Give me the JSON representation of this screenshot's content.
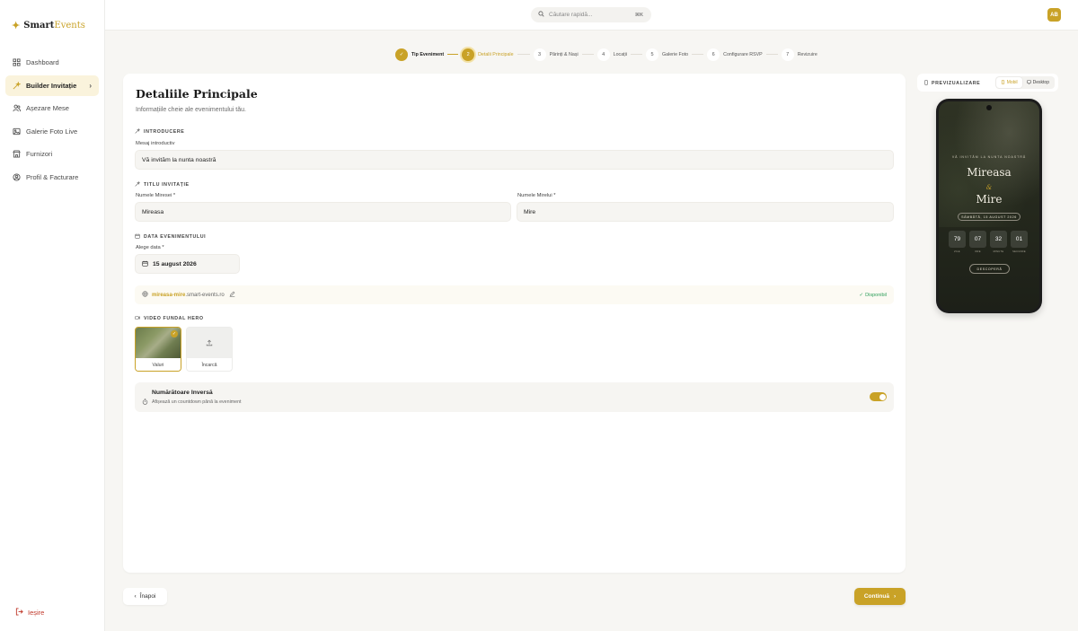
{
  "app": {
    "brand_name_part1": "Smart",
    "brand_name_part2": "Events",
    "accent_color": "#c9a227"
  },
  "sidebar": {
    "items": [
      {
        "label": "Dashboard",
        "icon": "grid-icon"
      },
      {
        "label": "Builder Invitație",
        "icon": "magic-wand-icon",
        "active": true
      },
      {
        "label": "Așezare Mese",
        "icon": "users-icon"
      },
      {
        "label": "Galerie Foto Live",
        "icon": "image-icon"
      },
      {
        "label": "Furnizori",
        "icon": "store-icon"
      },
      {
        "label": "Profil & Facturare",
        "icon": "user-circle-icon"
      }
    ],
    "logout_label": "Ieșire"
  },
  "topbar": {
    "search_placeholder": "Căutare rapidă...",
    "search_shortcut": "⌘K",
    "avatar_initials": "AB"
  },
  "stepper": {
    "steps": [
      {
        "number": "1",
        "label": "Tip Eveniment",
        "state": "done"
      },
      {
        "number": "2",
        "label": "Detalii Principale",
        "state": "current"
      },
      {
        "number": "3",
        "label": "Părinți & Nași",
        "state": "todo"
      },
      {
        "number": "4",
        "label": "Locații",
        "state": "todo"
      },
      {
        "number": "5",
        "label": "Galerie Foto",
        "state": "todo"
      },
      {
        "number": "6",
        "label": "Configurare RSVP",
        "state": "todo"
      },
      {
        "number": "7",
        "label": "Revizuire",
        "state": "todo"
      }
    ]
  },
  "form": {
    "title": "Detaliile Principale",
    "subtitle": "Informațiile cheie ale evenimentului tău.",
    "intro_section": "INTRODUCERE",
    "intro_label": "Mesaj introductiv",
    "intro_value": "Vă invităm la nunta noastră",
    "title_section": "TITLU INVITAȚIE",
    "bride_label": "Numele Miresei *",
    "bride_value": "Mireasa",
    "groom_label": "Numele Mirelui *",
    "groom_value": "Mire",
    "date_section": "DATA EVENIMENTULUI",
    "date_label": "Alege data *",
    "date_value": "15 august 2026",
    "url_slug": "mireasa-mire",
    "url_domain": ".smart-events.ro",
    "url_status": "Disponibil",
    "video_section": "VIDEO FUNDAL HERO",
    "video_options": [
      {
        "label": "Valuri",
        "selected": true
      },
      {
        "label": "Încarcă",
        "selected": false
      }
    ],
    "countdown_title": "Numărătoare Inversă",
    "countdown_desc": "Afișează un countdown până la eveniment",
    "countdown_enabled": true
  },
  "buttons": {
    "back_label": "Înapoi",
    "next_label": "Continuă"
  },
  "preview": {
    "title": "PREVIZUALIZARE",
    "mode_mobile": "Mobil",
    "mode_desktop": "Desktop",
    "active_mode": "Mobil",
    "phone": {
      "intro": "VĂ INVITĂM LA NUNTA NOASTRĂ",
      "bride": "Mireasa",
      "amp": "&",
      "groom": "Mire",
      "date": "SÂMBĂTĂ, 15 AUGUST 2026",
      "countdown": [
        {
          "value": "79",
          "unit": "ZILE"
        },
        {
          "value": "07",
          "unit": "ORE"
        },
        {
          "value": "32",
          "unit": "MINUTE"
        },
        {
          "value": "01",
          "unit": "SECUNDE"
        }
      ],
      "cta": "DESCOPERĂ"
    }
  }
}
